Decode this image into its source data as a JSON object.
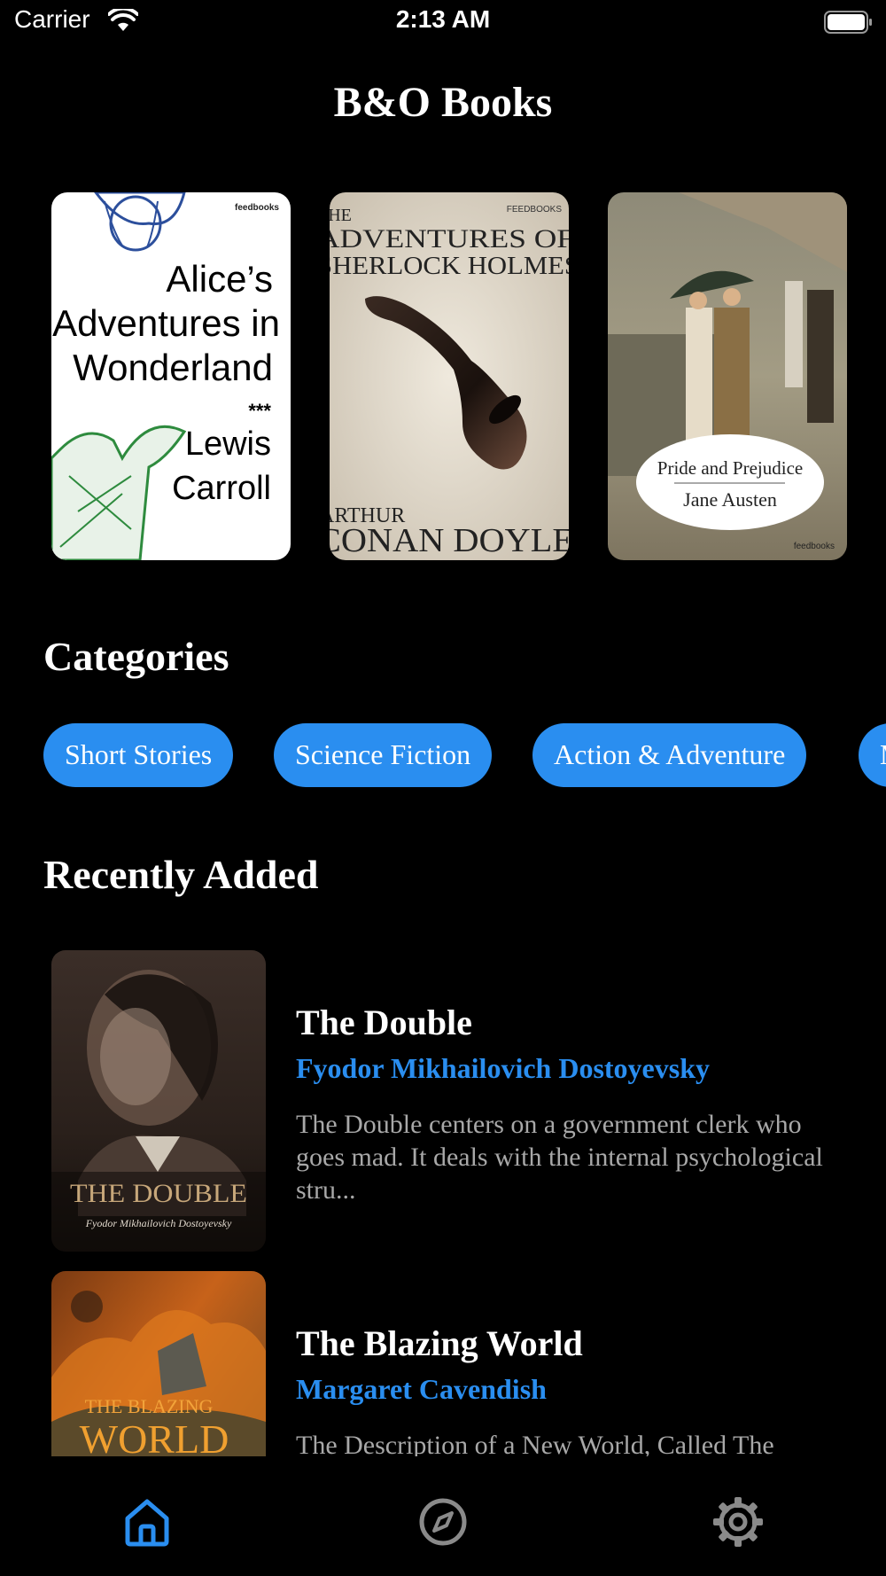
{
  "status_bar": {
    "carrier": "Carrier",
    "time": "2:13 AM"
  },
  "app_title": "B&O Books",
  "featured_books": [
    {
      "cover_lines": [
        "Alice’s",
        "Adventures in",
        "Wonderland",
        "***",
        "Lewis",
        "Carroll"
      ],
      "badge": "feedbooks"
    },
    {
      "cover_lines": [
        "THE",
        "ADVENTURES OF",
        "SHERLOCK HOLMES",
        "ARTHUR",
        "CONAN DOYLE"
      ],
      "badge": "FEEDBOOKS"
    },
    {
      "cover_lines": [
        "Pride and Prejudice",
        "Jane Austen"
      ],
      "badge": "feedbooks"
    }
  ],
  "categories_title": "Categories",
  "categories": [
    "Short Stories",
    "Science Fiction",
    "Action & Adventure",
    "Mystery"
  ],
  "recently_added_title": "Recently Added",
  "recent_books": [
    {
      "title": "The Double",
      "author": "Fyodor Mikhailovich Dostoyevsky",
      "description": "The Double centers on a government clerk who goes mad. It deals with the internal psychological stru...",
      "cover_title": "THE DOUBLE",
      "cover_author": "Fyodor Mikhailovich Dostoyevsky"
    },
    {
      "title": "The Blazing World",
      "author": "Margaret Cavendish",
      "description": "The Description of a New World, Called The Blazing-World",
      "cover_title_top": "THE BLAZING",
      "cover_title_bottom": "WORLD"
    }
  ],
  "tabs": [
    {
      "name": "home-icon",
      "active": true
    },
    {
      "name": "compass-icon",
      "active": false
    },
    {
      "name": "gear-icon",
      "active": false
    }
  ],
  "colors": {
    "accent": "#2a8ef0",
    "background": "#000000",
    "secondary_text": "#a8a8a8"
  }
}
